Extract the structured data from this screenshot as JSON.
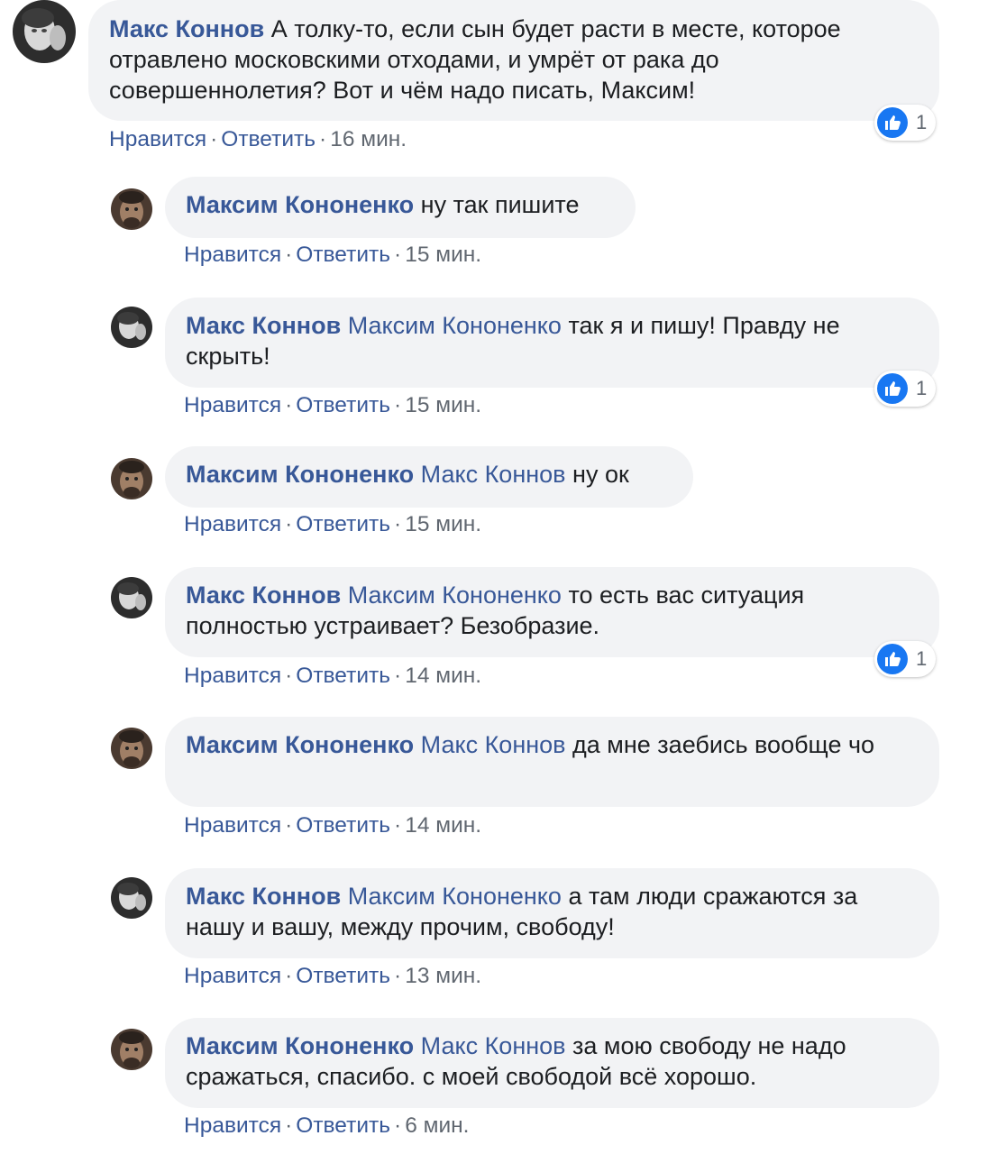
{
  "actions": {
    "like": "Нравится",
    "reply": "Ответить",
    "separator": "·"
  },
  "comments": [
    {
      "author": "Макс Коннов",
      "mention": "",
      "text": "А толку-то, если сын будет расти в месте, которое отравлено московскими отходами, и умрёт от рака до совершеннолетия? Вот и чём надо писать, Максим!",
      "time": "16 мин.",
      "likes": "1"
    },
    {
      "author": "Максим Кононенко",
      "mention": "",
      "text": "ну так пишите",
      "time": "15 мин.",
      "likes": ""
    },
    {
      "author": "Макс Коннов",
      "mention": "Максим Кононенко",
      "text": "так я и пишу! Правду не скрыть!",
      "time": "15 мин.",
      "likes": "1"
    },
    {
      "author": "Максим Кононенко",
      "mention": "Макс Коннов",
      "text": "ну ок",
      "time": "15 мин.",
      "likes": ""
    },
    {
      "author": "Макс Коннов",
      "mention": "Максим Кононенко",
      "text": "то есть вас ситуация полностью устраивает? Безобразие.",
      "time": "14 мин.",
      "likes": "1"
    },
    {
      "author": "Максим Кононенко",
      "mention": "Макс Коннов",
      "text": "да мне заебись вообще чо",
      "time": "14 мин.",
      "likes": ""
    },
    {
      "author": "Макс Коннов",
      "mention": "Максим Кононенко",
      "text": "а там люди сражаются за нашу и вашу, между прочим, свободу!",
      "time": "13 мин.",
      "likes": ""
    },
    {
      "author": "Максим Кононенко",
      "mention": "Макс Коннов",
      "text": "за мою свободу не надо сражаться, спасибо. с моей свободой всё хорошо.",
      "time": "6 мин.",
      "likes": ""
    }
  ],
  "colors": {
    "bubble": "#f2f3f5",
    "link": "#385898",
    "text": "#1c1e21",
    "meta": "#606770",
    "like_blue": "#1877f2"
  },
  "icons": {
    "avatar_a": "user-avatar-photo",
    "avatar_b": "user-avatar-photo",
    "reaction": "like-thumb-icon"
  }
}
